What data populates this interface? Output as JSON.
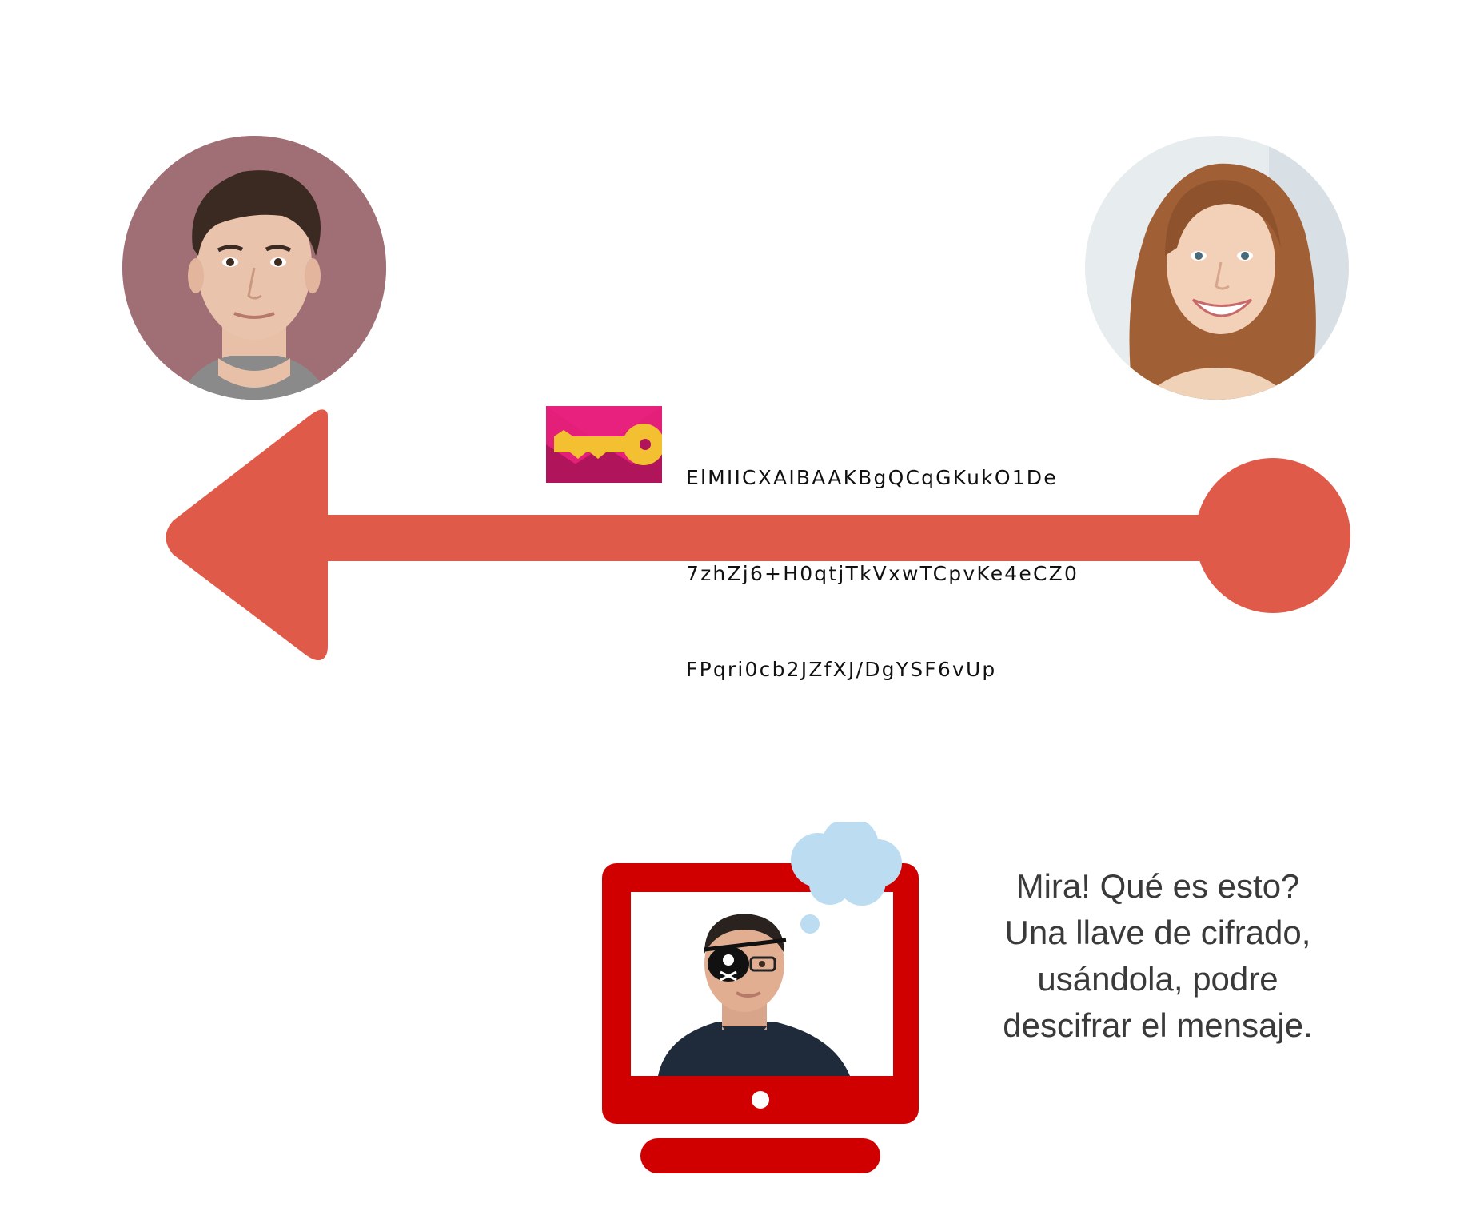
{
  "people": {
    "sender": {
      "name": "",
      "photo": "young man with dark hair, mauve wall background"
    },
    "receiver": {
      "name": "",
      "photo": "smiling woman with long auburn hair, light background"
    },
    "eavesdropper": {
      "photo": "man in navy polo wearing pirate eye patch with skull"
    }
  },
  "transfer": {
    "direction": "right-to-left",
    "key_lines": [
      "ElMIICXAIBAAKBgQCqGKukO1De",
      "7zhZj6+H0qtjTkVxwTCpvKe4eCZ0",
      "FPqri0cb2JZfXJ/DgYSF6vUp"
    ],
    "icons": [
      "envelope-key-icon",
      "arrow-icon",
      "monitor-icon",
      "thought-cloud-icon",
      "eye-patch-icon"
    ]
  },
  "thought": {
    "lines": [
      "Mira! Qué es esto?",
      "Una llave de cifrado,",
      "usándola, podre",
      "descifrar el mensaje."
    ]
  },
  "colors": {
    "arrow": "#e05a4a",
    "monitor": "#d10000",
    "envelope": "#e41f7a",
    "envelope_dark": "#b0145a",
    "key": "#f2c030",
    "cloud": "#bcdcf2"
  }
}
